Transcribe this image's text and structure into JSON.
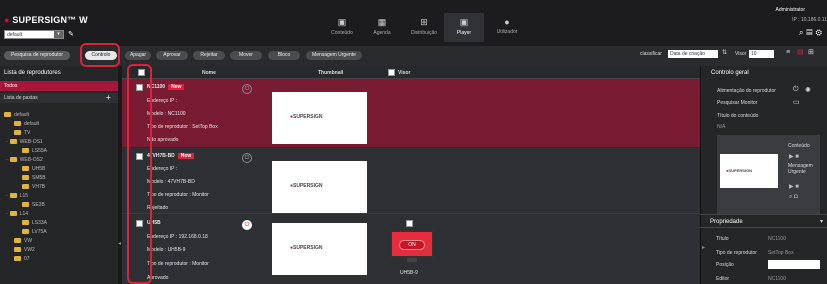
{
  "header": {
    "logo_text": "SUPERSIGN",
    "logo_suffix": "W",
    "site_select": "default",
    "nav": [
      {
        "label": "Conteúdo",
        "icon": "content-icon"
      },
      {
        "label": "Agenda",
        "icon": "calendar-icon"
      },
      {
        "label": "Distribuição",
        "icon": "distribution-icon"
      },
      {
        "label": "Player",
        "icon": "player-icon"
      },
      {
        "label": "Utilizador",
        "icon": "user-icon"
      }
    ],
    "user": "Administrator",
    "ip": "IP : 10.186.0.11",
    "accent_color": "#a8163b"
  },
  "toolbar": {
    "search_player": "Pesquisa de reprodutor",
    "control": "Controlo",
    "delete": "Apagar",
    "approve": "Aprovar",
    "reject": "Rejeitar",
    "move": "Mover",
    "block": "Bloco",
    "urgent_message": "Mensagem Urgente",
    "classify_label": "classificar",
    "classify_value": "Data de criação",
    "view_label": "Visor",
    "view_value": "10"
  },
  "left": {
    "title": "Lista de reprodutores",
    "all": "Todos",
    "folders_list": "Lista de pastas",
    "tree": [
      {
        "name": "default",
        "level": 0
      },
      {
        "name": "default",
        "level": 1
      },
      {
        "name": "TV",
        "level": 1
      },
      {
        "name": "WEB-OS1",
        "level": 1
      },
      {
        "name": "LS55A",
        "level": 2
      },
      {
        "name": "WEB-OS2",
        "level": 1
      },
      {
        "name": "UH5B",
        "level": 2
      },
      {
        "name": "SM5B",
        "level": 2
      },
      {
        "name": "VH7B",
        "level": 2
      },
      {
        "name": "L15",
        "level": 1
      },
      {
        "name": "SE3B",
        "level": 2
      },
      {
        "name": "L14",
        "level": 1
      },
      {
        "name": "LS33A",
        "level": 2
      },
      {
        "name": "LV75A",
        "level": 2
      },
      {
        "name": "VW",
        "level": 1
      },
      {
        "name": "VW2",
        "level": 1
      },
      {
        "name": "07",
        "level": 1
      }
    ]
  },
  "list": {
    "col_name": "Nome",
    "col_thumb": "Thumbnail",
    "col_view": "Visor",
    "rows": [
      {
        "name": "NC1100",
        "new": "New",
        "ip": "Endereço IP :",
        "model": "Modelo : NC1100",
        "type": "Tipo de reprodutor : SetTop Box",
        "status": "Não aprovado"
      },
      {
        "name": "47VH7B-BD",
        "new": "New",
        "ip": "Endereço IP :",
        "model": "Modelo : 47VH7B-BD",
        "type": "Tipo de reprodutor : Monitor",
        "status": "Rejeitado"
      },
      {
        "name": "UH5B",
        "ip": "Endereço IP : 192.168.0.18",
        "model": "Modelo : UH5B-9",
        "type": "Tipo de reprodutor : Monitor",
        "status": "Aprovado",
        "screen_state": "ON",
        "screen_label": "UH5B-9"
      }
    ],
    "thumb_logo": "SUPERSIGN"
  },
  "right": {
    "title": "Controlo geral",
    "power": "Alimentação do reprodutor",
    "search_monitor": "Pesquisar Monitor",
    "content_title": "Título do conteúdo",
    "content_title_value": "N/A",
    "content": "Conteúdo",
    "urgent": "Mensagem Urgente",
    "property_title": "Propriedade",
    "props": [
      {
        "label": "Título",
        "value": "NC1100"
      },
      {
        "label": "Tipo de reprodutor",
        "value": "SetTop Box"
      },
      {
        "label": "Posição",
        "value": ""
      },
      {
        "label": "Editor",
        "value": "NC1100"
      }
    ]
  }
}
